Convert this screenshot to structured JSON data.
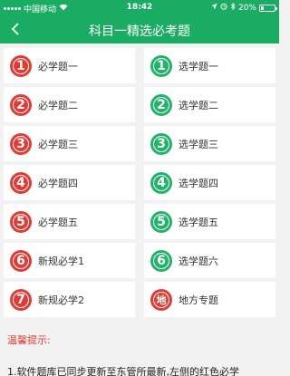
{
  "status_bar": {
    "carrier": "中国移动",
    "time": "18:42",
    "battery": "20%",
    "battery_level": 0.2
  },
  "nav": {
    "title": "科目一精选必考题"
  },
  "left_items": [
    {
      "badge": "1",
      "label": "必学题一"
    },
    {
      "badge": "2",
      "label": "必学题二"
    },
    {
      "badge": "3",
      "label": "必学题三"
    },
    {
      "badge": "4",
      "label": "必学题四"
    },
    {
      "badge": "5",
      "label": "必学题五"
    },
    {
      "badge": "6",
      "label": "新规必学1"
    },
    {
      "badge": "7",
      "label": "新规必学2"
    }
  ],
  "right_items": [
    {
      "badge": "1",
      "label": "选学题一"
    },
    {
      "badge": "2",
      "label": "选学题二"
    },
    {
      "badge": "3",
      "label": "选学题三"
    },
    {
      "badge": "4",
      "label": "选学题四"
    },
    {
      "badge": "5",
      "label": "选学题五"
    },
    {
      "badge": "6",
      "label": "选学题六"
    },
    {
      "badge": "地",
      "label": "地方专题"
    }
  ],
  "tips": {
    "title": "温馨提示:",
    "text": "1.软件题库已同步更新至东管所最新,左侧的红色必学"
  },
  "colors": {
    "brand_green": "#1aac62",
    "badge_red": "#e53a33",
    "badge_green": "#1fb468",
    "tip_red": "#e23b30"
  }
}
